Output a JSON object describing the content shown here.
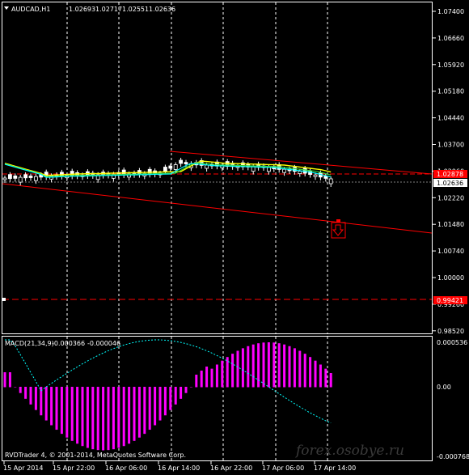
{
  "chart_header": {
    "symbol_label": "AUDCAD,H1",
    "ohlc": [
      "1.02693",
      "1.02717",
      "1.02551",
      "1.02636"
    ]
  },
  "macd_header": {
    "label": "MACD(21,34,9)",
    "values": [
      "-0.000366",
      "-0.000046"
    ]
  },
  "copyright": "RVDTrader 4, © 2001-2014, MetaQuotes Software Corp.",
  "watermark": "forex.osobye.ru",
  "price_axis": [
    "1.07400",
    "1.06660",
    "1.05920",
    "1.05180",
    "1.04440",
    "1.03700",
    "1.02960",
    "1.02220",
    "1.01480",
    "1.00740",
    "1.00000",
    "0.99260",
    "0.98520"
  ],
  "price_markers": {
    "current": "1.02636",
    "upper_line": "1.02878",
    "lower_line": "0.99421"
  },
  "macd_axis": [
    "0.000536",
    "0.00",
    "-0.000768"
  ],
  "time_axis": [
    "15 Apr 2014",
    "15 Apr 22:00",
    "16 Apr 06:00",
    "16 Apr 14:00",
    "16 Apr 22:00",
    "17 Apr 06:00",
    "17 Apr 14:00"
  ],
  "colors": {
    "background": "#000000",
    "grid": "#ffffff",
    "bull_candle": "#ffffff",
    "bear_candle": "#000000",
    "ma_yellow": "#ffff00",
    "ma_cyan": "#00ffff",
    "ma_green": "#32cd32",
    "trend_lines": "#ff0000",
    "macd_hist": "#ff00ff",
    "macd_signal": "#00ffff"
  },
  "chart_data": [
    {
      "type": "candlestick",
      "title": "AUDCAD,H1",
      "x": [
        "15 Apr 2014",
        "15 Apr 22:00",
        "16 Apr 06:00",
        "16 Apr 14:00",
        "16 Apr 22:00",
        "17 Apr 06:00",
        "17 Apr 14:00"
      ],
      "ylim": [
        0.9852,
        1.0774
      ],
      "last_close": 1.02636,
      "horizontal_levels": [
        1.02878,
        0.99421
      ],
      "sell_arrow_level": 1.0162
    },
    {
      "type": "bar",
      "title": "MACD(21,34,9)",
      "main_value": -0.000366,
      "signal_value": -4.6e-05,
      "ylim": [
        -0.000768,
        0.000536
      ]
    }
  ]
}
